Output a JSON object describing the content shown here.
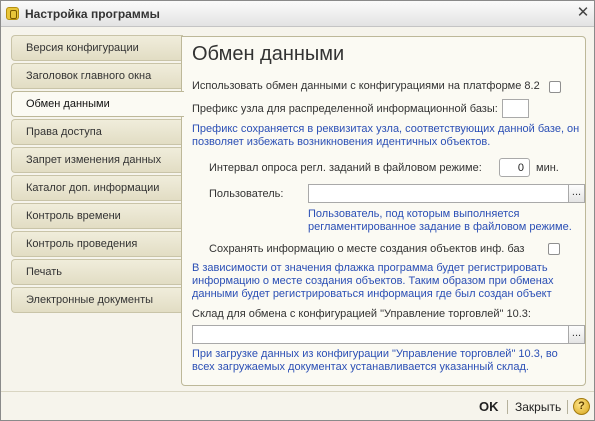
{
  "window": {
    "title": "Настройка программы"
  },
  "icons": {
    "app": "app-icon",
    "close": "close-icon",
    "help": "help-icon"
  },
  "sidebar": {
    "active_index": 2,
    "items": [
      {
        "label": "Версия конфигурации"
      },
      {
        "label": "Заголовок главного окна"
      },
      {
        "label": "Обмен данными"
      },
      {
        "label": "Права доступа"
      },
      {
        "label": "Запрет изменения данных"
      },
      {
        "label": "Каталог доп. информации"
      },
      {
        "label": "Контроль времени"
      },
      {
        "label": "Контроль проведения"
      },
      {
        "label": "Печать"
      },
      {
        "label": "Электронные документы"
      }
    ]
  },
  "main": {
    "heading": "Обмен данными",
    "use_exchange_82": {
      "label": "Использовать обмен данными с конфигурациями на платформе 8.2",
      "checked": false
    },
    "node_prefix": {
      "label": "Префикс узла для распределенной информационной базы:",
      "value": "",
      "note": "Префикс сохраняется в реквизитах узла, соответствующих данной базе, он позволяет избежать возникновения идентичных объектов."
    },
    "poll_interval": {
      "label": "Интервал опроса регл. заданий в файловом режиме:",
      "value": "0",
      "unit": "мин."
    },
    "user": {
      "label": "Пользователь:",
      "value": "",
      "select_button": "...",
      "note": "Пользователь, под которым выполняется регламентированное задание в файловом режиме."
    },
    "save_location": {
      "label": "Сохранять информацию о месте создания объектов инф. баз",
      "checked": false,
      "note": "В зависимости от значения флажка программа будет регистрировать информацию о месте создания объектов. Таким образом при обменах данными будет регистрироваться информация где был создан объект"
    },
    "warehouse": {
      "label": "Склад для обмена с конфигурацией \"Управление торговлей\" 10.3:",
      "value": "",
      "select_button": "...",
      "note": "При загрузке данных из конфигурации \"Управление торговлей\" 10.3, во всех загружаемых документах устанавливается указанный склад."
    }
  },
  "footer": {
    "ok": "OK",
    "close": "Закрыть",
    "help": "?"
  },
  "colors": {
    "note_blue": "#2b4fb5",
    "panel_bg": "#fbfaf3",
    "window_bg": "#f6f4ec"
  }
}
